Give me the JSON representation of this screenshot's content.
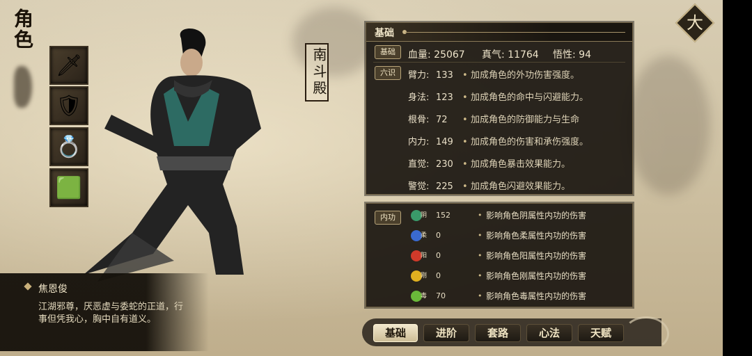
{
  "title": "角色",
  "school": "南斗殿",
  "close_icon_glyph": "大",
  "equipment": [
    {
      "name": "weapon",
      "icon": "🗡"
    },
    {
      "name": "armor",
      "icon": "🛡"
    },
    {
      "name": "ring",
      "icon": "💍"
    },
    {
      "name": "jade",
      "icon": "🟩"
    }
  ],
  "basic": {
    "header": "基础",
    "tag_basic": "基础",
    "hp_label": "血量:",
    "hp": "25067",
    "qi_label": "真气:",
    "qi": "11764",
    "wu_label": "悟性:",
    "wu": "94",
    "tag_six": "六识",
    "attrs": [
      {
        "name": "臂力:",
        "value": "133",
        "desc": "加成角色的外功伤害强度。"
      },
      {
        "name": "身法:",
        "value": "123",
        "desc": "加成角色的命中与闪避能力。"
      },
      {
        "name": "根骨:",
        "value": "72",
        "desc": "加成角色的防御能力与生命"
      },
      {
        "name": "内力:",
        "value": "149",
        "desc": "加成角色的伤害和承伤强度。"
      },
      {
        "name": "直觉:",
        "value": "230",
        "desc": "加成角色暴击效果能力。"
      },
      {
        "name": "警觉:",
        "value": "225",
        "desc": "加成角色闪避效果能力。"
      }
    ]
  },
  "inner": {
    "tag": "内功",
    "rows": [
      {
        "glyph": "阴",
        "value": "152",
        "desc": "影响角色阴属性内功的伤害",
        "color": "#3a9a6a"
      },
      {
        "glyph": "柔",
        "value": "0",
        "desc": "影响角色柔属性内功的伤害",
        "color": "#3a6ad0"
      },
      {
        "glyph": "阳",
        "value": "0",
        "desc": "影响角色阳属性内功的伤害",
        "color": "#d03a2a"
      },
      {
        "glyph": "刚",
        "value": "0",
        "desc": "影响角色刚属性内功的伤害",
        "color": "#e0b020"
      },
      {
        "glyph": "毒",
        "value": "70",
        "desc": "影响角色毒属性内功的伤害",
        "color": "#6ab83a"
      }
    ]
  },
  "bio": {
    "name": "焦恩俊",
    "text": "江湖邪尊，厌恶虚与委蛇的正道，行事但凭我心，胸中自有道义。"
  },
  "tabs": [
    "基础",
    "进阶",
    "套路",
    "心法",
    "天赋"
  ]
}
